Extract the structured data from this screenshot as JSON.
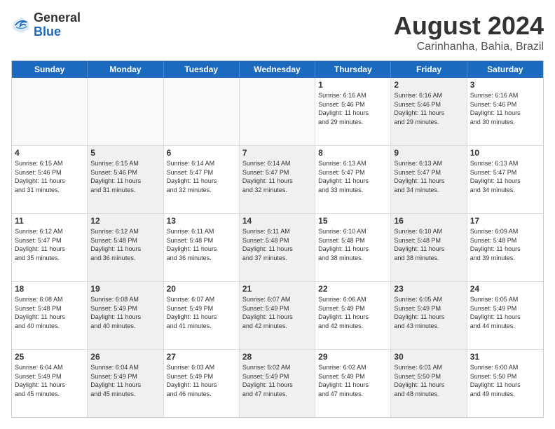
{
  "logo": {
    "general": "General",
    "blue": "Blue"
  },
  "title": "August 2024",
  "subtitle": "Carinhanha, Bahia, Brazil",
  "weekdays": [
    "Sunday",
    "Monday",
    "Tuesday",
    "Wednesday",
    "Thursday",
    "Friday",
    "Saturday"
  ],
  "weeks": [
    [
      {
        "day": "",
        "info": "",
        "shaded": true
      },
      {
        "day": "",
        "info": "",
        "shaded": true
      },
      {
        "day": "",
        "info": "",
        "shaded": true
      },
      {
        "day": "",
        "info": "",
        "shaded": true
      },
      {
        "day": "1",
        "info": "Sunrise: 6:16 AM\nSunset: 5:46 PM\nDaylight: 11 hours\nand 29 minutes.",
        "shaded": false
      },
      {
        "day": "2",
        "info": "Sunrise: 6:16 AM\nSunset: 5:46 PM\nDaylight: 11 hours\nand 29 minutes.",
        "shaded": true
      },
      {
        "day": "3",
        "info": "Sunrise: 6:16 AM\nSunset: 5:46 PM\nDaylight: 11 hours\nand 30 minutes.",
        "shaded": false
      }
    ],
    [
      {
        "day": "4",
        "info": "Sunrise: 6:15 AM\nSunset: 5:46 PM\nDaylight: 11 hours\nand 31 minutes.",
        "shaded": false
      },
      {
        "day": "5",
        "info": "Sunrise: 6:15 AM\nSunset: 5:46 PM\nDaylight: 11 hours\nand 31 minutes.",
        "shaded": true
      },
      {
        "day": "6",
        "info": "Sunrise: 6:14 AM\nSunset: 5:47 PM\nDaylight: 11 hours\nand 32 minutes.",
        "shaded": false
      },
      {
        "day": "7",
        "info": "Sunrise: 6:14 AM\nSunset: 5:47 PM\nDaylight: 11 hours\nand 32 minutes.",
        "shaded": true
      },
      {
        "day": "8",
        "info": "Sunrise: 6:13 AM\nSunset: 5:47 PM\nDaylight: 11 hours\nand 33 minutes.",
        "shaded": false
      },
      {
        "day": "9",
        "info": "Sunrise: 6:13 AM\nSunset: 5:47 PM\nDaylight: 11 hours\nand 34 minutes.",
        "shaded": true
      },
      {
        "day": "10",
        "info": "Sunrise: 6:13 AM\nSunset: 5:47 PM\nDaylight: 11 hours\nand 34 minutes.",
        "shaded": false
      }
    ],
    [
      {
        "day": "11",
        "info": "Sunrise: 6:12 AM\nSunset: 5:47 PM\nDaylight: 11 hours\nand 35 minutes.",
        "shaded": false
      },
      {
        "day": "12",
        "info": "Sunrise: 6:12 AM\nSunset: 5:48 PM\nDaylight: 11 hours\nand 36 minutes.",
        "shaded": true
      },
      {
        "day": "13",
        "info": "Sunrise: 6:11 AM\nSunset: 5:48 PM\nDaylight: 11 hours\nand 36 minutes.",
        "shaded": false
      },
      {
        "day": "14",
        "info": "Sunrise: 6:11 AM\nSunset: 5:48 PM\nDaylight: 11 hours\nand 37 minutes.",
        "shaded": true
      },
      {
        "day": "15",
        "info": "Sunrise: 6:10 AM\nSunset: 5:48 PM\nDaylight: 11 hours\nand 38 minutes.",
        "shaded": false
      },
      {
        "day": "16",
        "info": "Sunrise: 6:10 AM\nSunset: 5:48 PM\nDaylight: 11 hours\nand 38 minutes.",
        "shaded": true
      },
      {
        "day": "17",
        "info": "Sunrise: 6:09 AM\nSunset: 5:48 PM\nDaylight: 11 hours\nand 39 minutes.",
        "shaded": false
      }
    ],
    [
      {
        "day": "18",
        "info": "Sunrise: 6:08 AM\nSunset: 5:48 PM\nDaylight: 11 hours\nand 40 minutes.",
        "shaded": false
      },
      {
        "day": "19",
        "info": "Sunrise: 6:08 AM\nSunset: 5:49 PM\nDaylight: 11 hours\nand 40 minutes.",
        "shaded": true
      },
      {
        "day": "20",
        "info": "Sunrise: 6:07 AM\nSunset: 5:49 PM\nDaylight: 11 hours\nand 41 minutes.",
        "shaded": false
      },
      {
        "day": "21",
        "info": "Sunrise: 6:07 AM\nSunset: 5:49 PM\nDaylight: 11 hours\nand 42 minutes.",
        "shaded": true
      },
      {
        "day": "22",
        "info": "Sunrise: 6:06 AM\nSunset: 5:49 PM\nDaylight: 11 hours\nand 42 minutes.",
        "shaded": false
      },
      {
        "day": "23",
        "info": "Sunrise: 6:05 AM\nSunset: 5:49 PM\nDaylight: 11 hours\nand 43 minutes.",
        "shaded": true
      },
      {
        "day": "24",
        "info": "Sunrise: 6:05 AM\nSunset: 5:49 PM\nDaylight: 11 hours\nand 44 minutes.",
        "shaded": false
      }
    ],
    [
      {
        "day": "25",
        "info": "Sunrise: 6:04 AM\nSunset: 5:49 PM\nDaylight: 11 hours\nand 45 minutes.",
        "shaded": false
      },
      {
        "day": "26",
        "info": "Sunrise: 6:04 AM\nSunset: 5:49 PM\nDaylight: 11 hours\nand 45 minutes.",
        "shaded": true
      },
      {
        "day": "27",
        "info": "Sunrise: 6:03 AM\nSunset: 5:49 PM\nDaylight: 11 hours\nand 46 minutes.",
        "shaded": false
      },
      {
        "day": "28",
        "info": "Sunrise: 6:02 AM\nSunset: 5:49 PM\nDaylight: 11 hours\nand 47 minutes.",
        "shaded": true
      },
      {
        "day": "29",
        "info": "Sunrise: 6:02 AM\nSunset: 5:49 PM\nDaylight: 11 hours\nand 47 minutes.",
        "shaded": false
      },
      {
        "day": "30",
        "info": "Sunrise: 6:01 AM\nSunset: 5:50 PM\nDaylight: 11 hours\nand 48 minutes.",
        "shaded": true
      },
      {
        "day": "31",
        "info": "Sunrise: 6:00 AM\nSunset: 5:50 PM\nDaylight: 11 hours\nand 49 minutes.",
        "shaded": false
      }
    ]
  ]
}
